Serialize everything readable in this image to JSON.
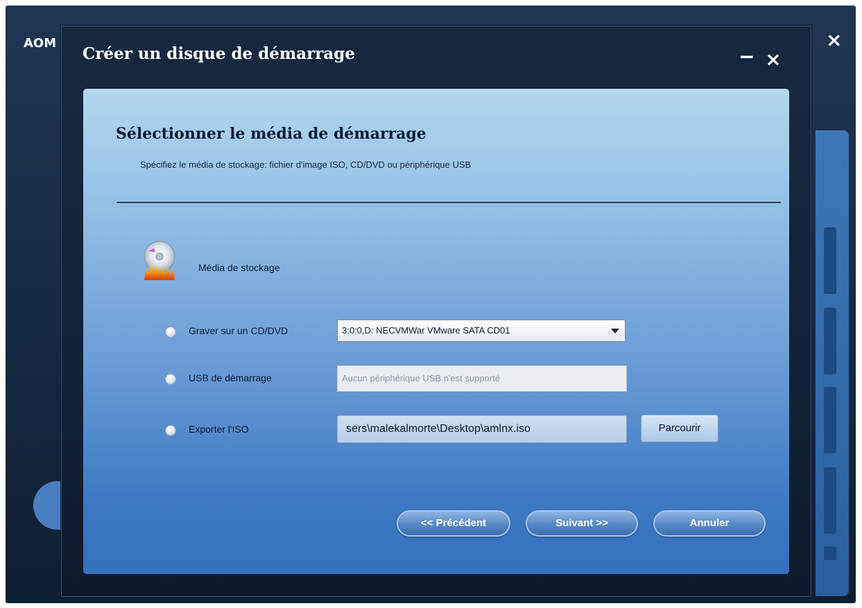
{
  "background_app": {
    "title": "AOM",
    "close_label": "×"
  },
  "dialog": {
    "title": "Créer un disque de démarrage",
    "minimize_label": "−",
    "close_label": "×"
  },
  "page": {
    "heading": "Sélectionner le média de démarrage",
    "subheading": "Spécifiez le média de stockage: fichier d'image ISO, CD/DVD ou périphérique USB"
  },
  "media": {
    "icon": "disc-burn-icon",
    "label": "Média de stockage"
  },
  "options": {
    "burn": {
      "label": "Graver sur un CD/DVD",
      "selected_value": "3:0:0,D: NECVMWar VMware SATA CD01"
    },
    "usb": {
      "label": "USB de démarrage",
      "placeholder": "Aucun périphérique USB n'est supporté"
    },
    "iso": {
      "label": "Exporter l'ISO",
      "value": "sers\\malekalmorte\\Desktop\\amlnx.iso",
      "browse_label": "Parcourir"
    }
  },
  "buttons": {
    "previous": "<< Précédent",
    "next": "Suivant >>",
    "cancel": "Annuler"
  },
  "colors": {
    "content_top": "#b4d6ef",
    "content_bottom": "#3470bd",
    "dialog_bg": "#17283f",
    "button_accent": "#5688c6"
  }
}
